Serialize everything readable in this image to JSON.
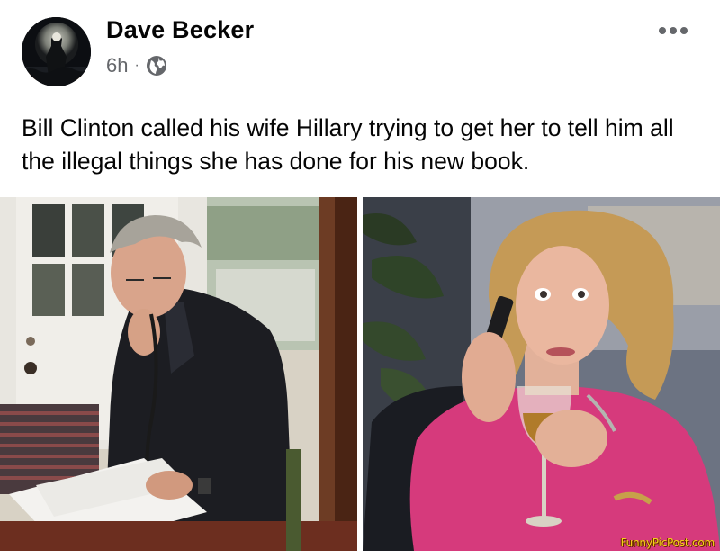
{
  "post": {
    "author_name": "Dave Becker",
    "timestamp": "6h",
    "separator": "·",
    "text": "Bill Clinton called his wife Hillary trying to get her to tell him all the illegal things she has done for his new book.",
    "watermark": "FunnyPicPost.com"
  },
  "icons": {
    "more": "more-options-icon",
    "privacy": "globe-icon"
  },
  "colors": {
    "name": "#050505",
    "meta": "#65676b",
    "watermark": "#f7d21a"
  }
}
